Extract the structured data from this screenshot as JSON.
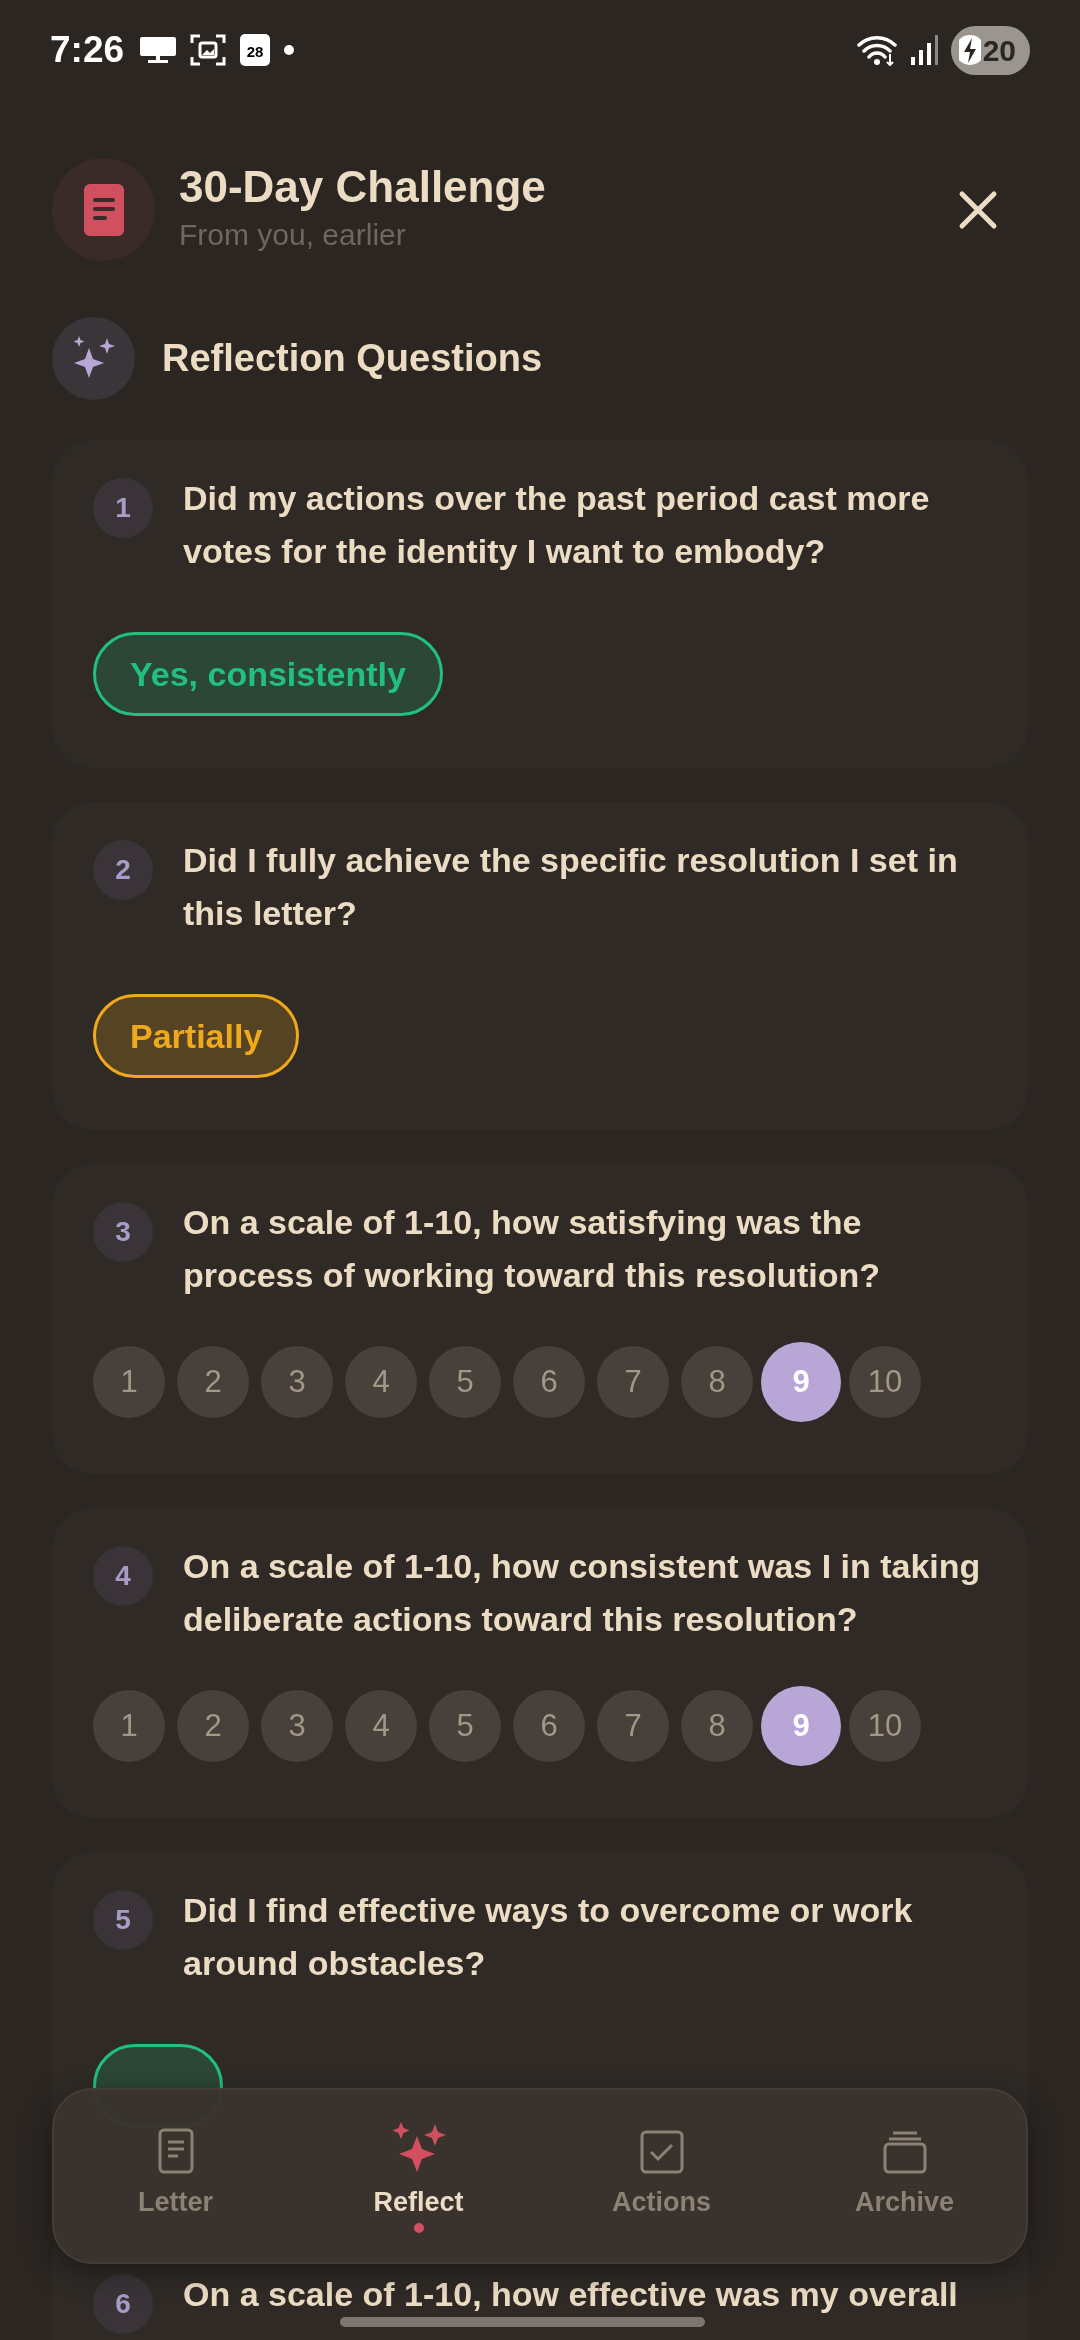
{
  "status_bar": {
    "time": "7:26",
    "calendar_day": "28",
    "battery": "20"
  },
  "header": {
    "title": "30-Day Challenge",
    "subtitle": "From you, earlier"
  },
  "section": {
    "title": "Reflection Questions"
  },
  "questions": [
    {
      "number": "1",
      "text": "Did my actions over the past period cast more votes for the identity I want to embody?",
      "kind": "choice",
      "answer": {
        "label": "Yes, consistently",
        "color": "#22c07f"
      }
    },
    {
      "number": "2",
      "text": "Did I fully achieve the specific resolution I set in this letter?",
      "kind": "choice",
      "answer": {
        "label": "Partially",
        "color": "#f0a81c"
      }
    },
    {
      "number": "3",
      "text": "On a scale of 1-10, how satisfying was the process of working toward this resolution?",
      "kind": "scale",
      "options": [
        {
          "label": "1",
          "selected": false
        },
        {
          "label": "2",
          "selected": false
        },
        {
          "label": "3",
          "selected": false
        },
        {
          "label": "4",
          "selected": false
        },
        {
          "label": "5",
          "selected": false
        },
        {
          "label": "6",
          "selected": false
        },
        {
          "label": "7",
          "selected": false
        },
        {
          "label": "8",
          "selected": false
        },
        {
          "label": "9",
          "selected": true
        },
        {
          "label": "10",
          "selected": false
        }
      ]
    },
    {
      "number": "4",
      "text": "On a scale of 1-10, how consistent was I in taking deliberate actions toward this resolution?",
      "kind": "scale",
      "options": [
        {
          "label": "1",
          "selected": false
        },
        {
          "label": "2",
          "selected": false
        },
        {
          "label": "3",
          "selected": false
        },
        {
          "label": "4",
          "selected": false
        },
        {
          "label": "5",
          "selected": false
        },
        {
          "label": "6",
          "selected": false
        },
        {
          "label": "7",
          "selected": false
        },
        {
          "label": "8",
          "selected": false
        },
        {
          "label": "9",
          "selected": true
        },
        {
          "label": "10",
          "selected": false
        }
      ]
    },
    {
      "number": "5",
      "text": "Did I find effective ways to overcome or work around obstacles?",
      "kind": "choice",
      "answer": {
        "color": "#22c07f"
      }
    },
    {
      "number": "6",
      "text": "On a scale of 1-10, how effective was my overall"
    }
  ],
  "nav": [
    {
      "label": "Letter",
      "selected": false
    },
    {
      "label": "Reflect",
      "selected": true
    },
    {
      "label": "Actions",
      "selected": false
    },
    {
      "label": "Archive",
      "selected": false
    }
  ]
}
